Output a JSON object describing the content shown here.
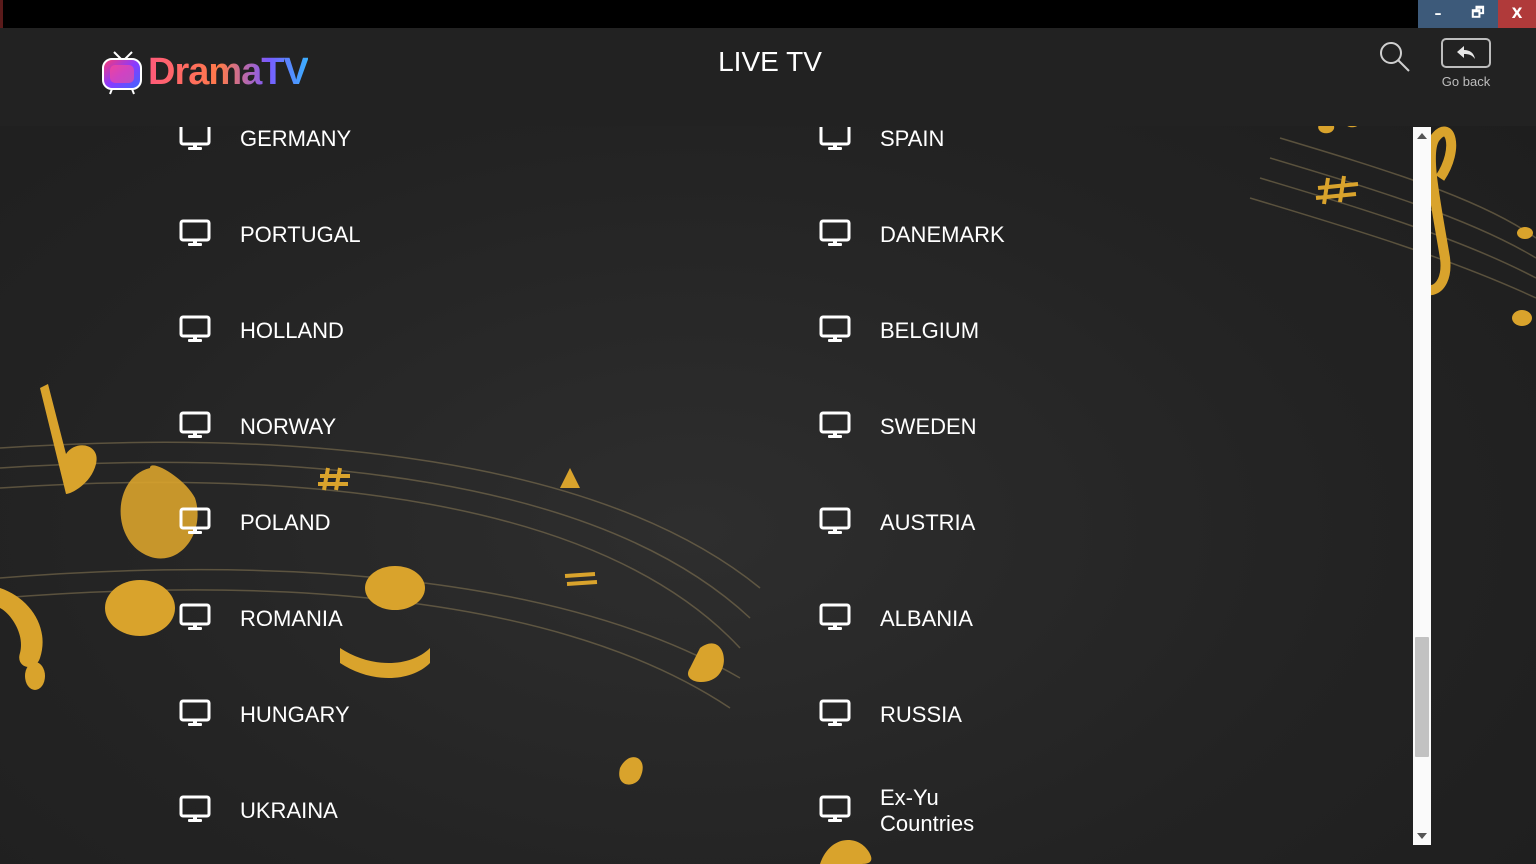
{
  "window": {
    "minimize_glyph": "–",
    "restore_glyph": "🗗",
    "close_glyph": "X"
  },
  "header": {
    "logo_text": "DramaTV",
    "title": "LIVE TV",
    "search_icon": "search-icon",
    "back_label": "Go back"
  },
  "colors": {
    "tile": "#4b3179",
    "accent_gold": "#e0a82e",
    "logo_gradient": [
      "#ff5a7a",
      "#7a5aff",
      "#3ab0ff"
    ]
  },
  "channels": [
    {
      "label": "GERMANY"
    },
    {
      "label": "SPAIN"
    },
    {
      "label": "PORTUGAL"
    },
    {
      "label": "DANEMARK"
    },
    {
      "label": "HOLLAND"
    },
    {
      "label": "BELGIUM"
    },
    {
      "label": "NORWAY"
    },
    {
      "label": "SWEDEN"
    },
    {
      "label": "POLAND"
    },
    {
      "label": "AUSTRIA"
    },
    {
      "label": "ROMANIA"
    },
    {
      "label": "ALBANIA"
    },
    {
      "label": "HUNGARY"
    },
    {
      "label": "RUSSIA"
    },
    {
      "label": "UKRAINA"
    },
    {
      "label": "Ex-Yu Countries"
    }
  ]
}
